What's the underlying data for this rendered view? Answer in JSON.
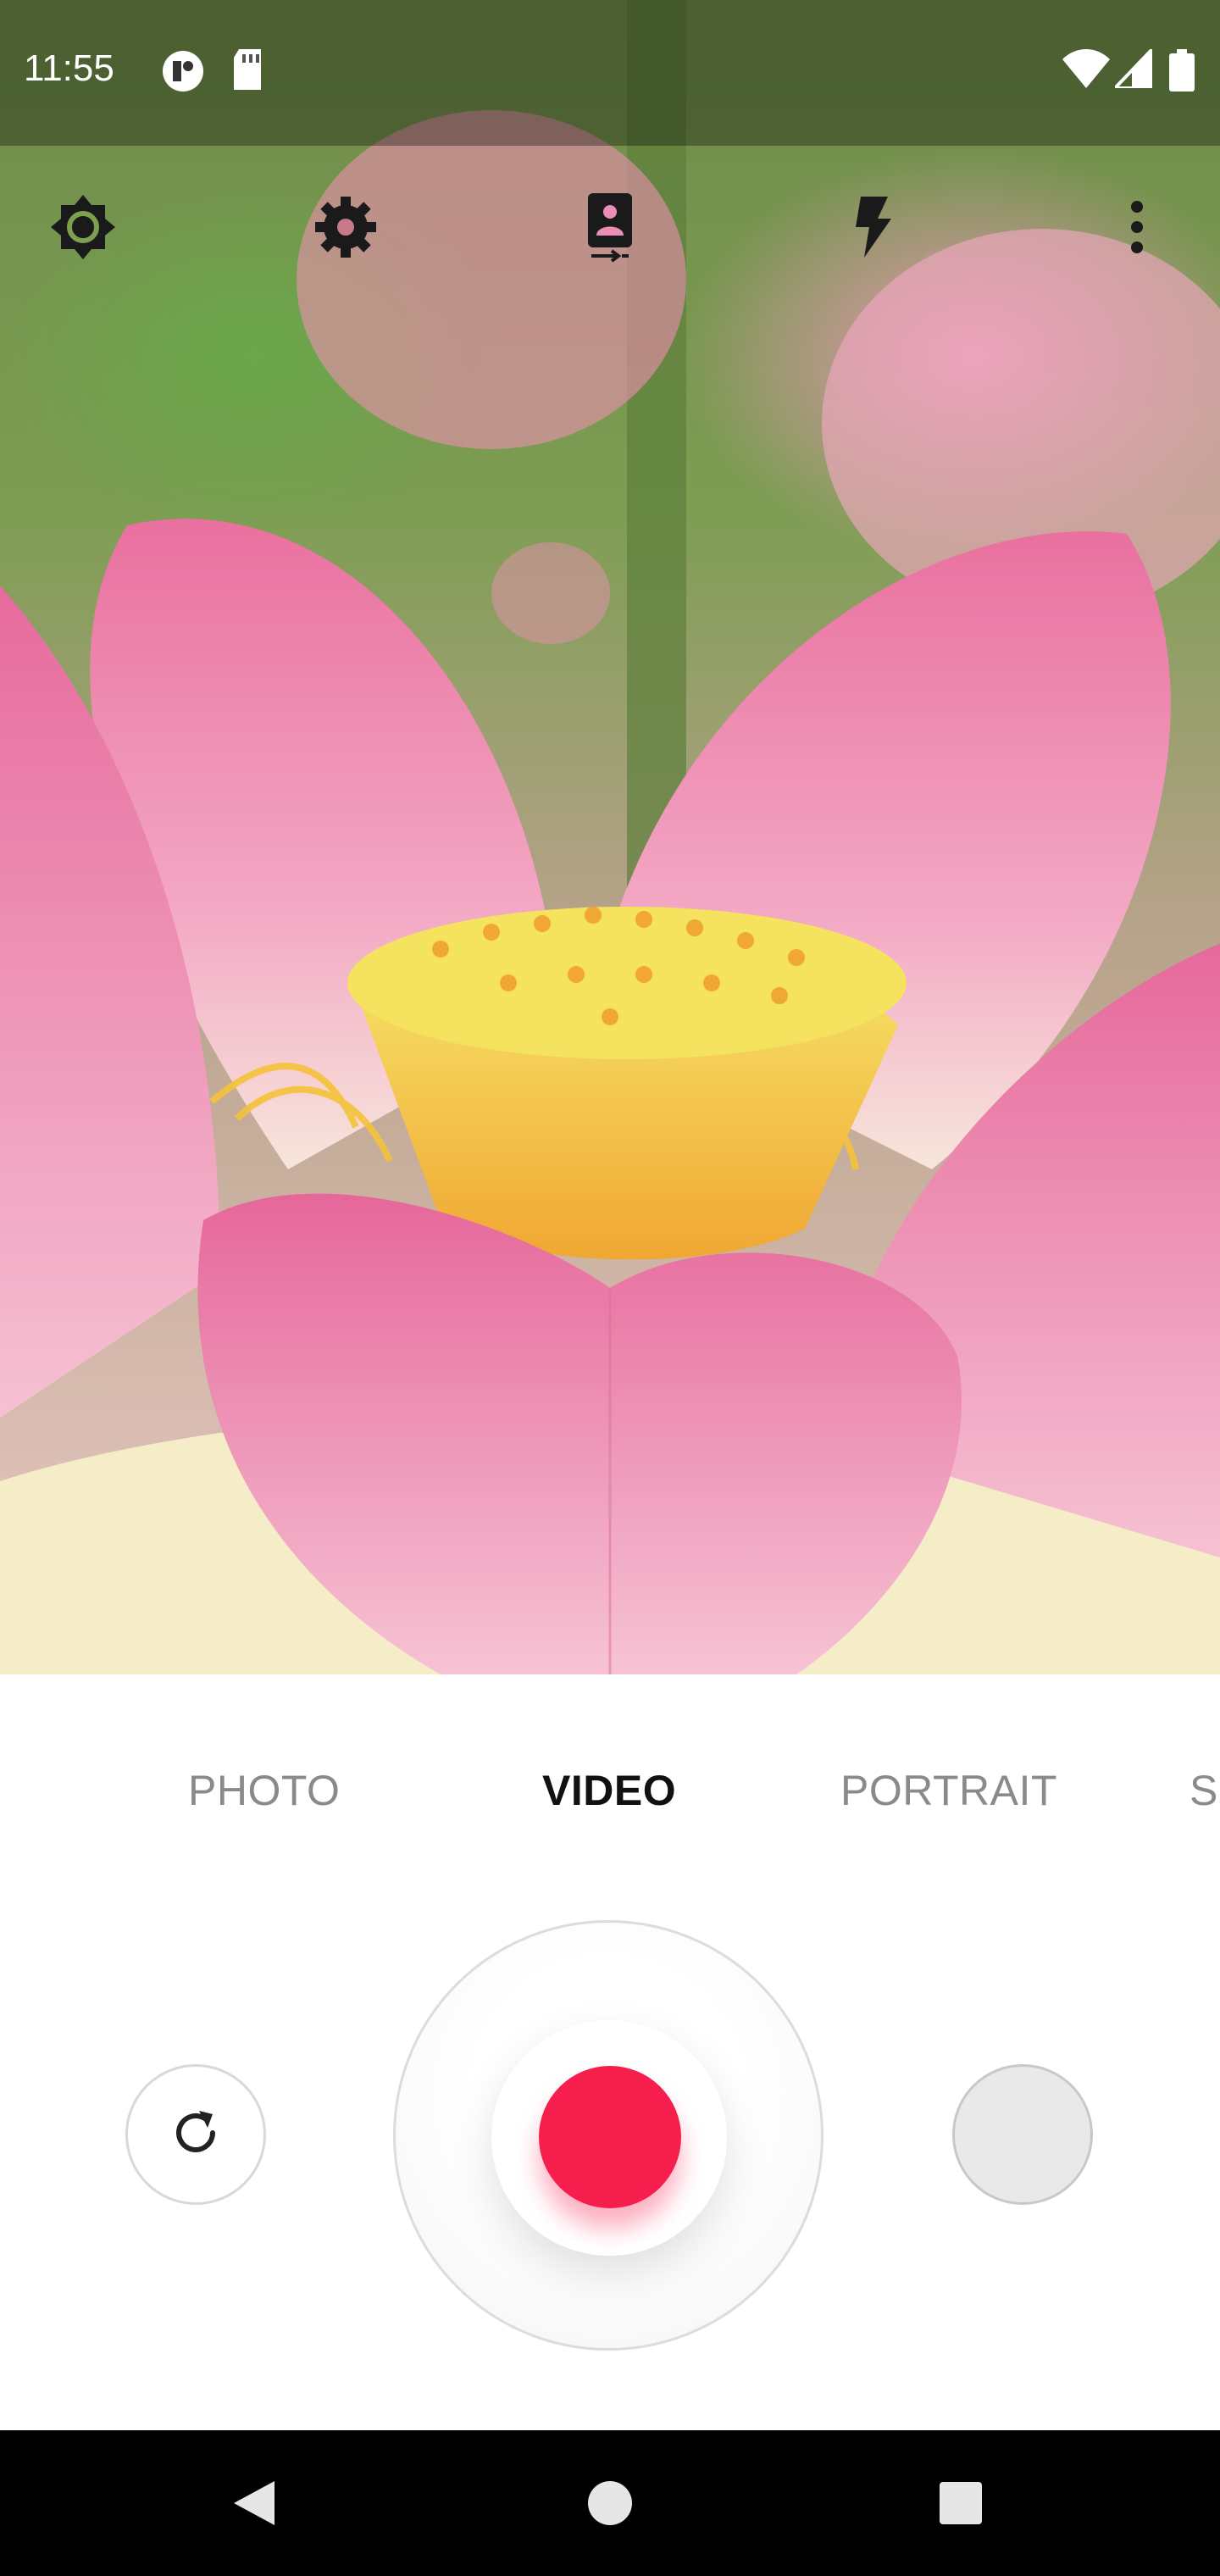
{
  "status_bar": {
    "time": "11:55",
    "left_icons": [
      "app-notification-icon",
      "sd-card-icon"
    ],
    "right_icons": [
      "wifi-icon",
      "cell-signal-icon",
      "battery-icon"
    ]
  },
  "toolbar": {
    "icons": [
      "brightness-icon",
      "settings-gear-icon",
      "switch-camera-icon",
      "flash-icon",
      "more-vert-icon"
    ]
  },
  "modes": {
    "items": [
      "PHOTO",
      "VIDEO",
      "PORTRAIT",
      "S"
    ],
    "active": "VIDEO"
  },
  "controls": {
    "record_color": "#f51e4c",
    "left_button_icon": "rotate-icon",
    "right_button": "gallery-thumbnail"
  },
  "nav_bar": {
    "icons": [
      "back-icon",
      "home-icon",
      "recents-icon"
    ]
  }
}
